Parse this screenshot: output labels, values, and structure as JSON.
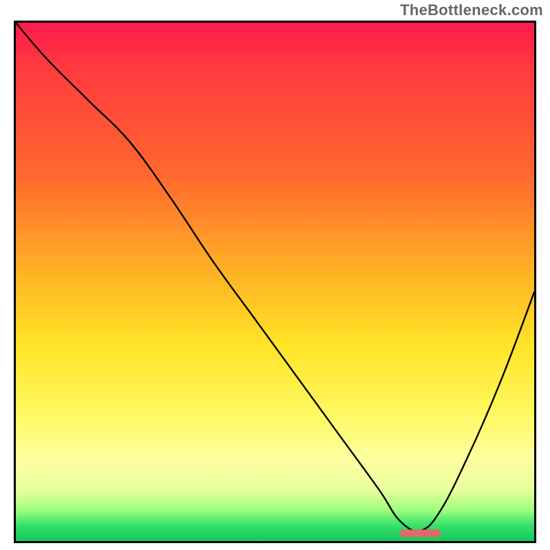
{
  "watermark": "TheBottleneck.com",
  "colors": {
    "gradient_top": "#ff1a4b",
    "gradient_mid1": "#ff6a2e",
    "gradient_mid2": "#ffe326",
    "gradient_mid3": "#fdffa0",
    "gradient_bottom": "#12c85c",
    "curve": "#000000",
    "marker": "#de6a6a",
    "border": "#000000"
  },
  "chart_data": {
    "type": "line",
    "title": "",
    "xlabel": "",
    "ylabel": "",
    "xlim": [
      0,
      100
    ],
    "ylim": [
      0,
      100
    ],
    "note": "Single black curve over vertical red→green gradient; large V shape with minimum near x≈78. Short coral marker segment at minimum. Values eyeballed from pixel positions.",
    "series": [
      {
        "name": "bottleneck-curve",
        "x": [
          0,
          6,
          14,
          22,
          30,
          38,
          46,
          54,
          62,
          70,
          74,
          78,
          82,
          88,
          94,
          100
        ],
        "y": [
          100,
          93,
          85,
          77,
          66,
          54,
          43,
          32,
          21,
          10,
          4,
          2,
          6,
          18,
          32,
          48
        ]
      }
    ],
    "marker": {
      "name": "optimal-point-marker",
      "x_start": 74,
      "x_end": 82,
      "y": 1.5,
      "color": "#de6a6a"
    },
    "background_gradient_stops": [
      {
        "pos": 0,
        "color": "#ff1a4b"
      },
      {
        "pos": 8,
        "color": "#ff3840"
      },
      {
        "pos": 30,
        "color": "#ff6a2e"
      },
      {
        "pos": 48,
        "color": "#ffb224"
      },
      {
        "pos": 62,
        "color": "#ffe326"
      },
      {
        "pos": 75,
        "color": "#fff85e"
      },
      {
        "pos": 84,
        "color": "#fdffa0"
      },
      {
        "pos": 90,
        "color": "#e9ff9e"
      },
      {
        "pos": 94,
        "color": "#9fff7e"
      },
      {
        "pos": 97,
        "color": "#35e06a"
      },
      {
        "pos": 100,
        "color": "#12c85c"
      }
    ]
  }
}
